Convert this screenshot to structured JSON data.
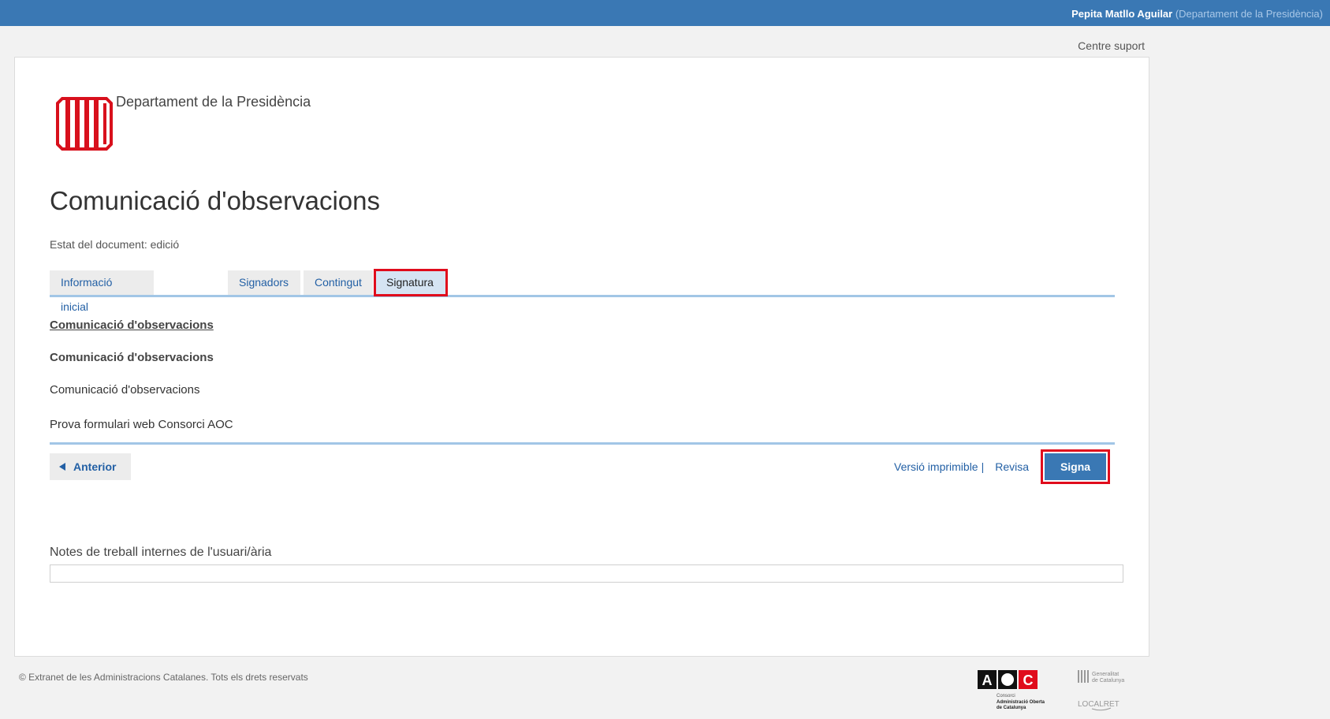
{
  "topbar": {
    "user_name": "Pepita Matllo Aguilar",
    "user_dept": "(Departament de la Presidència)"
  },
  "support_link": "Centre suport",
  "header": {
    "department": "Departament de la Presidència",
    "logo_icon": "generalitat-senyera-logo"
  },
  "page": {
    "title": "Comunicació d'observacions",
    "status": "Estat del document: edició"
  },
  "tabs": [
    {
      "label": "Informació inicial"
    },
    {
      "label": "Signadors"
    },
    {
      "label": "Contingut"
    },
    {
      "label": "Signatura"
    }
  ],
  "content": {
    "lines": [
      "Comunicació d'observacions",
      "Comunicació d'observacions",
      "Comunicació d'observacions",
      "Prova formulari web Consorci AOC"
    ]
  },
  "actions": {
    "previous_label": "Anterior",
    "printable_label": "Versió imprimible",
    "separator": "|",
    "review_label": "Revisa",
    "sign_label": "Signa"
  },
  "notes": {
    "label": "Notes de treball internes de l'usuari/ària",
    "value": ""
  },
  "footer": {
    "copyright": "© Extranet de les Administracions Catalanes. Tots els drets reservats",
    "aoc_text": "AOC",
    "aoc_caption_1": "Consorci",
    "aoc_caption_2": "Administració Oberta",
    "aoc_caption_3": "de Catalunya",
    "gencat_line_1": "Generalitat",
    "gencat_line_2": "de Catalunya",
    "localret_text": "LOCALRET"
  },
  "colors": {
    "topbar": "#3a78b4",
    "link": "#2360a5",
    "highlight": "#e00c1c",
    "tab_rule": "#a2c6e6"
  }
}
